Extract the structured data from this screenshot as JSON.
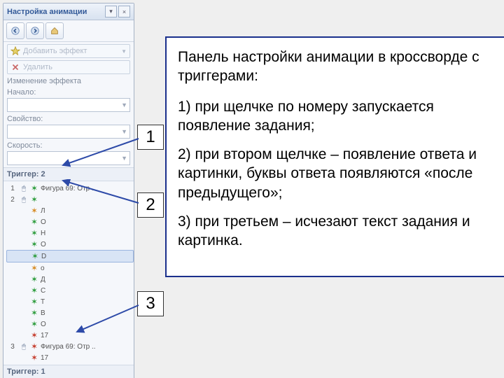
{
  "panel": {
    "title": "Настройка анимации",
    "close_tip": "×",
    "dropdown_tip": "▾",
    "add_effect": "Добавить эффект",
    "remove": "Удалить",
    "change_section": "Изменение эффекта",
    "start_label": "Начало:",
    "property_label": "Свойство:",
    "speed_label": "Скорость:",
    "group2_label": "Триггер: 2",
    "group1_label": "Триггер: 1",
    "rows2": [
      {
        "n": "1",
        "mouse": true,
        "eff": "green",
        "name": "Фигура 69: Отр .."
      },
      {
        "n": "2",
        "mouse": true,
        "eff": "green",
        "name": ""
      },
      {
        "n": "",
        "mouse": false,
        "eff": "orange",
        "name": "Л"
      },
      {
        "n": "",
        "mouse": false,
        "eff": "green",
        "name": "О"
      },
      {
        "n": "",
        "mouse": false,
        "eff": "green",
        "name": "Н"
      },
      {
        "n": "",
        "mouse": false,
        "eff": "green",
        "name": "О"
      },
      {
        "n": "",
        "mouse": false,
        "eff": "green",
        "name": "D",
        "sel": true
      },
      {
        "n": "",
        "mouse": false,
        "eff": "orange",
        "name": "о"
      },
      {
        "n": "",
        "mouse": false,
        "eff": "green",
        "name": "Д"
      },
      {
        "n": "",
        "mouse": false,
        "eff": "green",
        "name": "С"
      },
      {
        "n": "",
        "mouse": false,
        "eff": "green",
        "name": "Т"
      },
      {
        "n": "",
        "mouse": false,
        "eff": "green",
        "name": "В"
      },
      {
        "n": "",
        "mouse": false,
        "eff": "green",
        "name": "О"
      },
      {
        "n": "",
        "mouse": false,
        "eff": "red",
        "name": "17"
      },
      {
        "n": "3",
        "mouse": true,
        "eff": "red",
        "name": "Фигура 69: Отр .."
      },
      {
        "n": "",
        "mouse": false,
        "eff": "red",
        "name": "17"
      }
    ]
  },
  "callout": {
    "heading": "Панель настройки анимации в кроссворде с триггерами:",
    "item1": "1) при щелчке по номеру запускается появление задания;",
    "item2": "2) при втором щелчке – появление ответа и картинки, буквы ответа появляются «после предыдущего»;",
    "item3": "3) при третьем – исчезают текст задания и картинка."
  },
  "labels": {
    "n1": "1",
    "n2": "2",
    "n3": "3"
  }
}
